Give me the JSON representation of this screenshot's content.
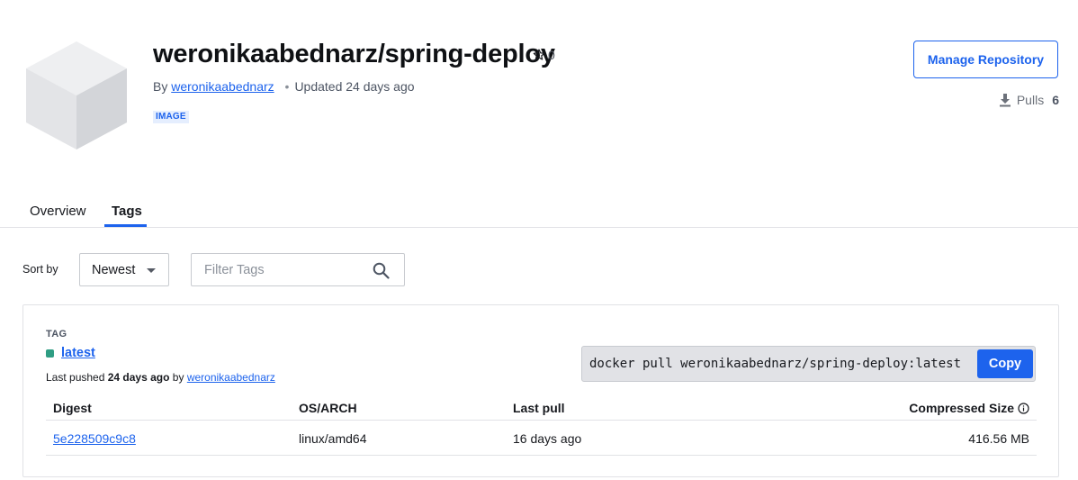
{
  "repo": {
    "title": "weronikaabednarz/spring-deploy",
    "stars": "0",
    "by_label": "By",
    "owner": "weronikaabednarz",
    "updated": "Updated 24 days ago",
    "type_badge": "IMAGE",
    "manage_label": "Manage Repository",
    "pulls_label": "Pulls",
    "pulls_count": "6"
  },
  "tabs": [
    {
      "label": "Overview",
      "active": false
    },
    {
      "label": "Tags",
      "active": true
    }
  ],
  "controls": {
    "sort_label": "Sort by",
    "sort_value": "Newest",
    "filter_placeholder": "Filter Tags"
  },
  "tag_card": {
    "caption": "TAG",
    "tag_name": "latest",
    "status_color": "#2f9d83",
    "pushed_prefix": "Last pushed",
    "pushed_when": "24 days ago",
    "pushed_by_label": "by",
    "pushed_by": "weronikaabednarz",
    "pull_command": "docker pull weronikaabednarz/spring-deploy:latest",
    "copy_label": "Copy",
    "columns": [
      "Digest",
      "OS/ARCH",
      "Last pull",
      "Compressed Size"
    ],
    "rows": [
      {
        "digest": "5e228509c9c8",
        "os_arch": "linux/amd64",
        "last_pull": "16 days ago",
        "size": "416.56 MB"
      }
    ]
  },
  "colors": {
    "accent": "#1d63ed",
    "text": "#17191e",
    "muted": "#4d5563",
    "border": "#e1e2e6"
  },
  "icons": [
    "cube-logo-icon",
    "star-icon",
    "download-icon",
    "chevron-down-icon",
    "search-icon",
    "info-icon"
  ]
}
